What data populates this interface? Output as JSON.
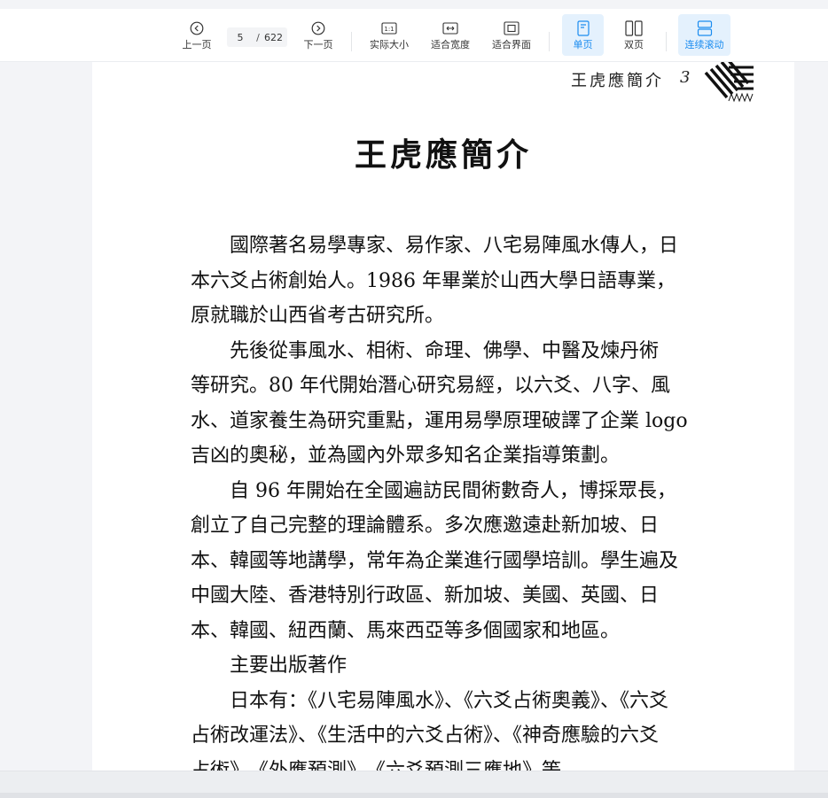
{
  "toolbar": {
    "prev_label": "上一页",
    "current_page": "5",
    "page_sep": "/",
    "total_pages": "622",
    "next_label": "下一页",
    "actual_size_label": "实际大小",
    "actual_size_icon_text": "1:1",
    "fit_width_label": "适合宽度",
    "fit_page_label": "适合界面",
    "single_page_label": "单页",
    "double_page_label": "双页",
    "continuous_label": "连续滚动",
    "accent_color": "#1a8cf0"
  },
  "document": {
    "running_header": "王虎應簡介",
    "running_page_number": "3",
    "title": "王虎應簡介",
    "lines": [
      "國際著名易學專家、易作家、八宅易陣風水傳人，日",
      "本六爻占術創始人。1986 年畢業於山西大學日語專業，",
      "原就職於山西省考古研究所。",
      "先後從事風水、相術、命理、佛學、中醫及煉丹術",
      "等研究。80 年代開始潛心研究易經，以六爻、八字、風",
      "水、道家養生為研究重點，運用易學原理破譯了企業 logo",
      "吉凶的奧秘，並為國內外眾多知名企業指導策劃。",
      "自 96 年開始在全國遍訪民間術數奇人，博採眾長，",
      "創立了自己完整的理論體系。多次應邀遠赴新加坡、日",
      "本、韓國等地講學，常年為企業進行國學培訓。學生遍及",
      "中國大陸、香港特別行政區、新加坡、美國、英國、日",
      "本、韓國、紐西蘭、馬來西亞等多個國家和地區。",
      "主要出版著作",
      "日本有：《八宅易陣風水》、《六爻占術奧義》、《六爻",
      "占術改運法》、《生活中的六爻占術》、《神奇應驗的六爻",
      "占術》、《外應預測》、《六爻預測三應地》等。"
    ]
  }
}
